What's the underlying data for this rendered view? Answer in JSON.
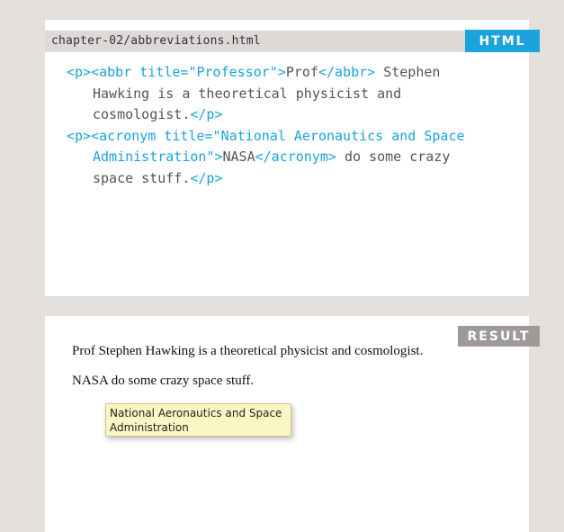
{
  "code_panel": {
    "filename": "chapter-02/abbreviations.html",
    "tag": "HTML",
    "lines": [
      [
        {
          "t": "<p><abbr title=\"Professor\">"
        },
        {
          "x": "Prof"
        },
        {
          "t": "</abbr>"
        },
        {
          "x": " Stephen"
        }
      ],
      [
        {
          "x": "Hawking is a theoretical physicist and"
        }
      ],
      [
        {
          "x": "cosmologist."
        },
        {
          "t": "</p>"
        }
      ],
      [
        {
          "t": "<p><acronym title=\"National Aeronautics and Space"
        }
      ],
      [
        {
          "t": "Administration\">"
        },
        {
          "x": "NASA"
        },
        {
          "t": "</acronym>"
        },
        {
          "x": " do some crazy"
        }
      ],
      [
        {
          "x": "space stuff."
        },
        {
          "t": "</p>"
        }
      ]
    ],
    "indent": [
      false,
      true,
      true,
      false,
      true,
      true
    ]
  },
  "result_panel": {
    "tag": "RESULT",
    "line1": "Prof Stephen Hawking is a theoretical physicist and cosmologist.",
    "line2": "NASA do some crazy space stuff.",
    "tooltip": "National Aeronautics and Space\nAdministration"
  }
}
